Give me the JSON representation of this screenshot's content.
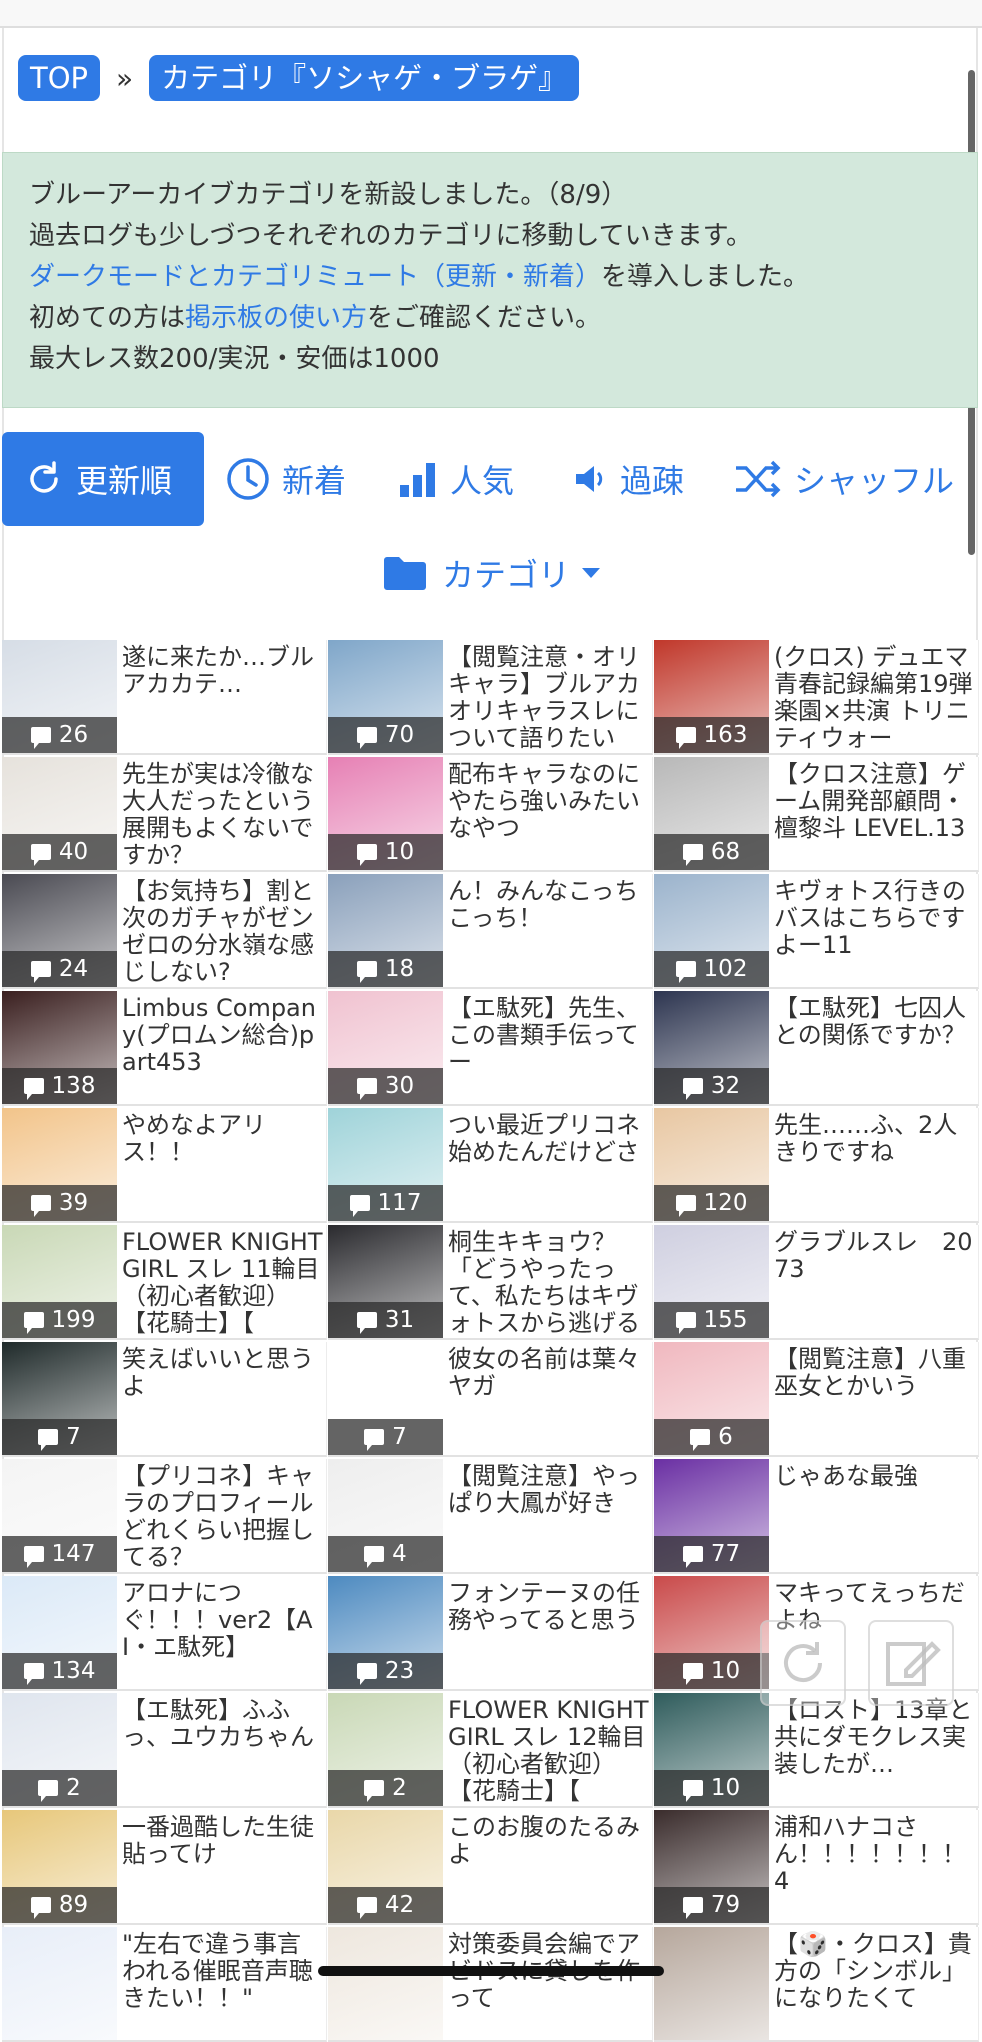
{
  "breadcrumb": {
    "top": "TOP",
    "separator": "»",
    "current": "カテゴリ『ソシャゲ・ブラゲ』"
  },
  "notice": {
    "line1": "ブルーアーカイブカテゴリを新設しました。（8/9）",
    "line2": "過去ログも少しづつそれぞれのカテゴリに移動していきます。",
    "line3_link": "ダークモードとカテゴリミュート（更新・新着）",
    "line3_rest": "を導入しました。",
    "line4_pre": "初めての方は",
    "line4_link": "掲示板の使い方",
    "line4_post": "をご確認ください。",
    "line5": "最大レス数200/実況・安価は1000"
  },
  "tabs": [
    {
      "label": "更新順",
      "icon": "refresh-icon"
    },
    {
      "label": "新着",
      "icon": "clock-icon"
    },
    {
      "label": "人気",
      "icon": "bar-chart-icon"
    },
    {
      "label": "過疎",
      "icon": "speaker-icon"
    },
    {
      "label": "シャッフル",
      "icon": "shuffle-icon"
    }
  ],
  "category_button": {
    "label": "カテゴリ",
    "icon": "folder-icon"
  },
  "threads": [
    {
      "title": "遂に来たか…ブルアカカテ…",
      "count": "26",
      "color": "#d6dde6"
    },
    {
      "title": "【閲覧注意・オリキャラ】ブルアカオリキャラスレについて語りたい",
      "count": "70",
      "color": "#7fa6c9"
    },
    {
      "title": "(クロス) デュエマ 青春記録編第19弾　楽園×共演 トリニティウォー",
      "count": "163",
      "color": "#c0372a"
    },
    {
      "title": "先生が実は冷徹な大人だったという展開もよくないですか？",
      "count": "40",
      "color": "#e6e2dc"
    },
    {
      "title": "配布キャラなのにやたら強いみたいなやつ",
      "count": "10",
      "color": "#e680b4"
    },
    {
      "title": "【クロス注意】ゲーム開発部顧問・檀黎斗 LEVEL.13",
      "count": "68",
      "color": "#b8b8b8"
    },
    {
      "title": "【お気持ち】割と次のガチャがゼンゼロの分水嶺な感じしない?",
      "count": "24",
      "color": "#4a4a52"
    },
    {
      "title": "ん！みんなこっちこっち！",
      "count": "18",
      "color": "#8aa0bb"
    },
    {
      "title": "キヴォトス行きのバスはこちらですよー11",
      "count": "102",
      "color": "#9bb3cc"
    },
    {
      "title": "Limbus Company(プロムン総合)part453",
      "count": "138",
      "color": "#3a1f1f"
    },
    {
      "title": "【エ駄死】先生、この書類手伝ってー",
      "count": "30",
      "color": "#f0c2d0"
    },
    {
      "title": "【エ駄死】七囚人との関係ですか？",
      "count": "32",
      "color": "#2d3550"
    },
    {
      "title": "やめなよアリス！！",
      "count": "39",
      "color": "#f2c48a"
    },
    {
      "title": "つい最近プリコネ始めたんだけどさ",
      "count": "117",
      "color": "#9fd3d9"
    },
    {
      "title": "先生……ふ、2人きりですね",
      "count": "120",
      "color": "#e8c7a2"
    },
    {
      "title": "FLOWER KNIGHT GIRL スレ 11輪目（初心者歓迎）【花騎士】【",
      "count": "199",
      "color": "#c9d8b6"
    },
    {
      "title": "桐生キキョウ？「どうやったって、私たちはキヴォトスから逃げること",
      "count": "31",
      "color": "#2a2a2e"
    },
    {
      "title": "グラブルスレ　2073",
      "count": "155",
      "color": "#cfcfe0"
    },
    {
      "title": "笑えばいいと思うよ",
      "count": "7",
      "color": "#1f2a2a"
    },
    {
      "title": "彼女の名前は葉々ヤガ",
      "count": "7",
      "color": "#ffffff"
    },
    {
      "title": "【閲覧注意】八重巫女とかいう",
      "count": "6",
      "color": "#f0b8bf"
    },
    {
      "title": "【プリコネ】キャラのプロフィールどれくらい把握してる？",
      "count": "147",
      "color": "#f4f4f4"
    },
    {
      "title": "【閲覧注意】やっぱり大鳳が好き",
      "count": "4",
      "color": "#eeeeee"
    },
    {
      "title": "じゃあな最強",
      "count": "77",
      "color": "#6a2fa3"
    },
    {
      "title": "アロナにつぐ！！！ver2【AI・エ駄死】",
      "count": "134",
      "color": "#dbe9f7"
    },
    {
      "title": "フォンテーヌの任務やってると思う",
      "count": "23",
      "color": "#4d8ac0"
    },
    {
      "title": "マキってえっちだよね",
      "count": "10",
      "color": "#c94a4a"
    },
    {
      "title": "【エ駄死】ふふっ、ユウカちゃん",
      "count": "2",
      "color": "#dfe5ee"
    },
    {
      "title": "FLOWER KNIGHT GIRL スレ 12輪目（初心者歓迎）【花騎士】【",
      "count": "2",
      "color": "#c9d8b6"
    },
    {
      "title": "【ロスト】13章と共にダモクレス実装したが…",
      "count": "10",
      "color": "#2f5c5c"
    },
    {
      "title": "一番過酷した生徒貼ってけ",
      "count": "89",
      "color": "#e7c77a"
    },
    {
      "title": "このお腹のたるみよ",
      "count": "42",
      "color": "#e9d7a9"
    },
    {
      "title": "浦和ハナコさん！！！！！！！4",
      "count": "79",
      "color": "#3a2c2c"
    },
    {
      "title": "\"左右で違う事言われる催眠音声聴きたい！！\"",
      "count": "",
      "color": "#e8eef8"
    },
    {
      "title": "対策委員会編でアビドスに貸しを作って",
      "count": "",
      "color": "#eee7de"
    },
    {
      "title": "【🎲・クロス】貴方の「シンボル」になりたくて",
      "count": "",
      "color": "#b6a79c"
    }
  ]
}
